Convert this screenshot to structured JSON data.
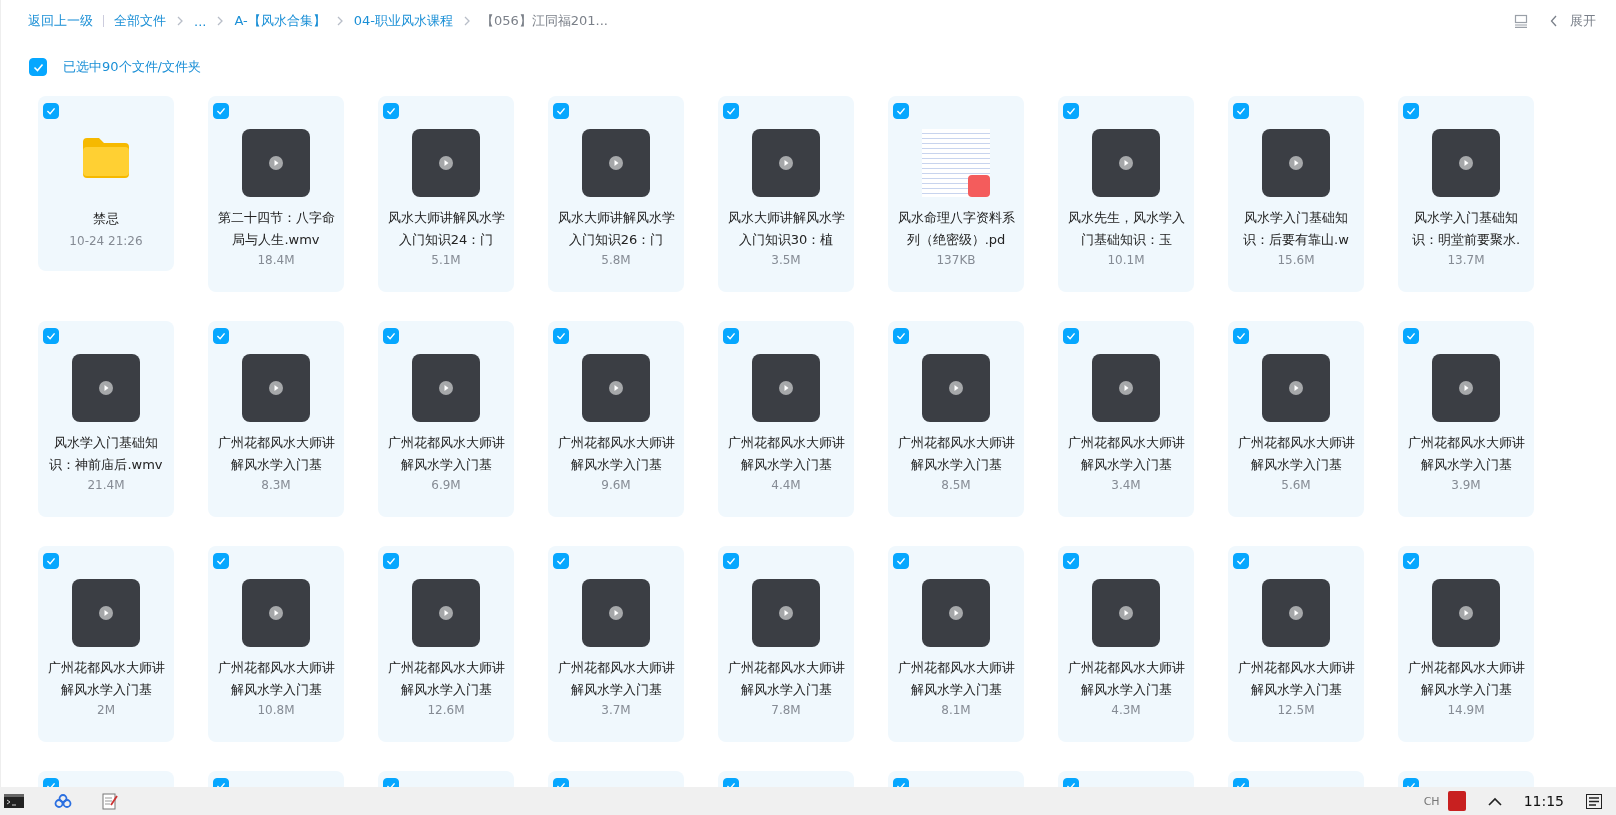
{
  "breadcrumb": {
    "back": "返回上一级",
    "items": [
      {
        "label": "全部文件",
        "current": false
      },
      {
        "label": "...",
        "current": false
      },
      {
        "label": "A-【风水合集】",
        "current": false
      },
      {
        "label": "04-职业风水课程",
        "current": false
      },
      {
        "label": "【056】江同福201...",
        "current": true
      }
    ]
  },
  "toolbar": {
    "expand": "展开"
  },
  "select_all": {
    "checked": true,
    "label": "已选中90个文件/文件夹"
  },
  "files": [
    {
      "kind": "folder",
      "name": "禁忌",
      "meta": "10-24 21:26",
      "selected": true
    },
    {
      "kind": "video",
      "name": "第二十四节：八字命局与人生.wmv",
      "meta": "18.4M",
      "selected": true
    },
    {
      "kind": "video",
      "name": "风水大师讲解风水学入门知识24：门",
      "meta": "5.1M",
      "selected": true
    },
    {
      "kind": "video",
      "name": "风水大师讲解风水学入门知识26：门",
      "meta": "5.8M",
      "selected": true
    },
    {
      "kind": "video",
      "name": "风水大师讲解风水学入门知识30：植",
      "meta": "3.5M",
      "selected": true
    },
    {
      "kind": "pdf",
      "name": "风水命理八字资料系列（绝密级）.pd",
      "meta": "137KB",
      "selected": true
    },
    {
      "kind": "video",
      "name": "风水先生，风水学入门基础知识：玉",
      "meta": "10.1M",
      "selected": true
    },
    {
      "kind": "video",
      "name": "风水学入门基础知识：后要有靠山.w",
      "meta": "15.6M",
      "selected": true
    },
    {
      "kind": "video",
      "name": "风水学入门基础知识：明堂前要聚水.",
      "meta": "13.7M",
      "selected": true
    },
    {
      "kind": "video",
      "name": "风水学入门基础知识：神前庙后.wmv",
      "meta": "21.4M",
      "selected": true
    },
    {
      "kind": "video",
      "name": "广州花都风水大师讲解风水学入门基",
      "meta": "8.3M",
      "selected": true
    },
    {
      "kind": "video",
      "name": "广州花都风水大师讲解风水学入门基",
      "meta": "6.9M",
      "selected": true
    },
    {
      "kind": "video",
      "name": "广州花都风水大师讲解风水学入门基",
      "meta": "9.6M",
      "selected": true
    },
    {
      "kind": "video",
      "name": "广州花都风水大师讲解风水学入门基",
      "meta": "4.4M",
      "selected": true
    },
    {
      "kind": "video",
      "name": "广州花都风水大师讲解风水学入门基",
      "meta": "8.5M",
      "selected": true
    },
    {
      "kind": "video",
      "name": "广州花都风水大师讲解风水学入门基",
      "meta": "3.4M",
      "selected": true
    },
    {
      "kind": "video",
      "name": "广州花都风水大师讲解风水学入门基",
      "meta": "5.6M",
      "selected": true
    },
    {
      "kind": "video",
      "name": "广州花都风水大师讲解风水学入门基",
      "meta": "3.9M",
      "selected": true
    },
    {
      "kind": "video",
      "name": "广州花都风水大师讲解风水学入门基",
      "meta": "2M",
      "selected": true
    },
    {
      "kind": "video",
      "name": "广州花都风水大师讲解风水学入门基",
      "meta": "10.8M",
      "selected": true
    },
    {
      "kind": "video",
      "name": "广州花都风水大师讲解风水学入门基",
      "meta": "12.6M",
      "selected": true
    },
    {
      "kind": "video",
      "name": "广州花都风水大师讲解风水学入门基",
      "meta": "3.7M",
      "selected": true
    },
    {
      "kind": "video",
      "name": "广州花都风水大师讲解风水学入门基",
      "meta": "7.8M",
      "selected": true
    },
    {
      "kind": "video",
      "name": "广州花都风水大师讲解风水学入门基",
      "meta": "8.1M",
      "selected": true
    },
    {
      "kind": "video",
      "name": "广州花都风水大师讲解风水学入门基",
      "meta": "4.3M",
      "selected": true
    },
    {
      "kind": "video",
      "name": "广州花都风水大师讲解风水学入门基",
      "meta": "12.5M",
      "selected": true
    },
    {
      "kind": "video",
      "name": "广州花都风水大师讲解风水学入门基",
      "meta": "14.9M",
      "selected": true
    },
    {
      "kind": "hidden",
      "selected": true
    },
    {
      "kind": "hidden",
      "selected": true
    },
    {
      "kind": "hidden",
      "selected": true
    },
    {
      "kind": "hidden",
      "selected": true
    },
    {
      "kind": "hidden",
      "selected": true
    },
    {
      "kind": "hidden",
      "selected": true
    },
    {
      "kind": "hidden",
      "selected": true
    },
    {
      "kind": "hidden",
      "selected": true
    },
    {
      "kind": "hidden",
      "selected": true
    }
  ],
  "taskbar": {
    "input_method": "CH",
    "time": "11:15"
  }
}
